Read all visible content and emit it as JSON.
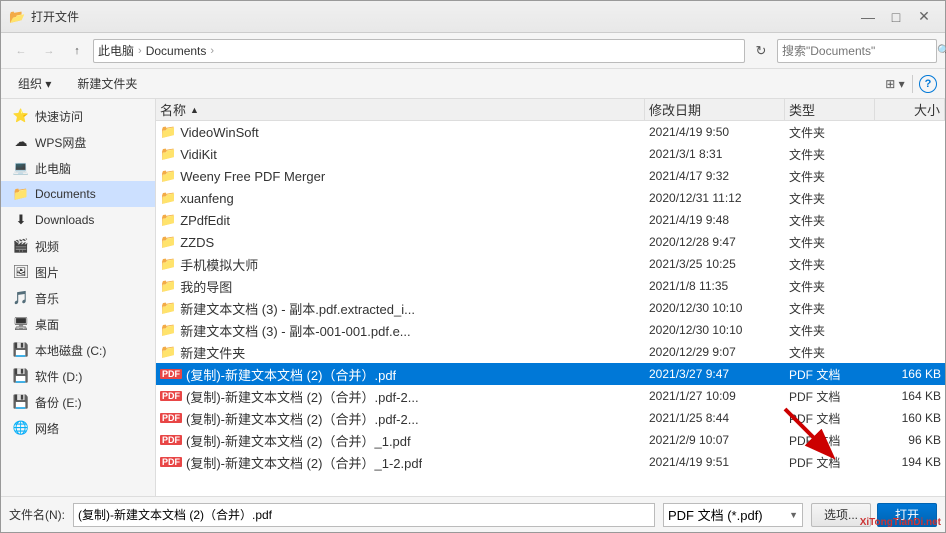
{
  "window": {
    "title": "打开文件",
    "icon": "📁"
  },
  "toolbar": {
    "back_label": "←",
    "forward_label": "→",
    "up_label": "↑",
    "breadcrumb": {
      "parts": [
        "此电脑",
        "Documents"
      ]
    },
    "refresh_label": "⟳",
    "search_placeholder": "搜索\"Documents\"",
    "search_icon": "🔍"
  },
  "action_bar": {
    "organize_label": "组织 ▾",
    "new_folder_label": "新建文件夹"
  },
  "sidebar": {
    "items": [
      {
        "id": "quick-access",
        "label": "快速访问",
        "icon": "⭐"
      },
      {
        "id": "wps",
        "label": "WPS网盘",
        "icon": "☁"
      },
      {
        "id": "this-pc",
        "label": "此电脑",
        "icon": "💻"
      },
      {
        "id": "documents",
        "label": "Documents",
        "icon": "📁",
        "selected": true
      },
      {
        "id": "downloads",
        "label": "Downloads",
        "icon": "⬇"
      },
      {
        "id": "videos",
        "label": "视频",
        "icon": "🎬"
      },
      {
        "id": "pictures",
        "label": "图片",
        "icon": "🖼"
      },
      {
        "id": "music",
        "label": "音乐",
        "icon": "🎵"
      },
      {
        "id": "desktop",
        "label": "桌面",
        "icon": "🖥"
      },
      {
        "id": "local-c",
        "label": "本地磁盘 (C:)",
        "icon": "💾"
      },
      {
        "id": "software-d",
        "label": "软件 (D:)",
        "icon": "💾"
      },
      {
        "id": "backup-e",
        "label": "备份 (E:)",
        "icon": "💾"
      },
      {
        "id": "network",
        "label": "网络",
        "icon": "🌐"
      }
    ]
  },
  "file_list": {
    "columns": {
      "name": "名称",
      "date": "修改日期",
      "type": "类型",
      "size": "大小"
    },
    "sort_column": "name",
    "sort_direction": "asc",
    "rows": [
      {
        "id": 1,
        "name": "VideoWinSoft",
        "date": "2021/4/19 9:50",
        "type": "文件夹",
        "size": "",
        "is_folder": true,
        "selected": false
      },
      {
        "id": 2,
        "name": "VidiKit",
        "date": "2021/3/1 8:31",
        "type": "文件夹",
        "size": "",
        "is_folder": true,
        "selected": false
      },
      {
        "id": 3,
        "name": "Weeny Free PDF Merger",
        "date": "2021/4/17 9:32",
        "type": "文件夹",
        "size": "",
        "is_folder": true,
        "selected": false
      },
      {
        "id": 4,
        "name": "xuanfeng",
        "date": "2020/12/31 11:12",
        "type": "文件夹",
        "size": "",
        "is_folder": true,
        "selected": false
      },
      {
        "id": 5,
        "name": "ZPdfEdit",
        "date": "2021/4/19 9:48",
        "type": "文件夹",
        "size": "",
        "is_folder": true,
        "selected": false
      },
      {
        "id": 6,
        "name": "ZZDS",
        "date": "2020/12/28 9:47",
        "type": "文件夹",
        "size": "",
        "is_folder": true,
        "selected": false
      },
      {
        "id": 7,
        "name": "手机模拟大师",
        "date": "2021/3/25 10:25",
        "type": "文件夹",
        "size": "",
        "is_folder": true,
        "selected": false
      },
      {
        "id": 8,
        "name": "我的导图",
        "date": "2021/1/8 11:35",
        "type": "文件夹",
        "size": "",
        "is_folder": true,
        "selected": false
      },
      {
        "id": 9,
        "name": "新建文本文档 (3) - 副本.pdf.extracted_i...",
        "date": "2020/12/30 10:10",
        "type": "文件夹",
        "size": "",
        "is_folder": true,
        "selected": false
      },
      {
        "id": 10,
        "name": "新建文本文档 (3) - 副本-001-001.pdf.e...",
        "date": "2020/12/30 10:10",
        "type": "文件夹",
        "size": "",
        "is_folder": true,
        "selected": false
      },
      {
        "id": 11,
        "name": "新建文件夹",
        "date": "2020/12/29 9:07",
        "type": "文件夹",
        "size": "",
        "is_folder": true,
        "selected": false
      },
      {
        "id": 12,
        "name": "(复制)-新建文本文档 (2)（合并）.pdf",
        "date": "2021/3/27 9:47",
        "type": "PDF 文档",
        "size": "166 KB",
        "is_folder": false,
        "selected": true
      },
      {
        "id": 13,
        "name": "(复制)-新建文本文档 (2)（合并）.pdf-2...",
        "date": "2021/1/27 10:09",
        "type": "PDF 文档",
        "size": "164 KB",
        "is_folder": false,
        "selected": false
      },
      {
        "id": 14,
        "name": "(复制)-新建文本文档 (2)（合并）.pdf-2...",
        "date": "2021/1/25 8:44",
        "type": "PDF 文档",
        "size": "160 KB",
        "is_folder": false,
        "selected": false
      },
      {
        "id": 15,
        "name": "(复制)-新建文本文档 (2)（合并）_1.pdf",
        "date": "2021/2/9 10:07",
        "type": "PDF 文档",
        "size": "96 KB",
        "is_folder": false,
        "selected": false
      },
      {
        "id": 16,
        "name": "(复制)-新建文本文档 (2)（合并）_1-2.pdf",
        "date": "2021/4/19 9:51",
        "type": "PDF 文档",
        "size": "194 KB",
        "is_folder": false,
        "selected": false
      }
    ]
  },
  "bottom": {
    "filename_label": "文件名(N):",
    "filename_value": "(复制)-新建文本文档 (2)（合并）.pdf",
    "filetype_value": "PDF 文档 (*.pdf)",
    "open_label": "打开",
    "cancel_label": "选项..."
  },
  "titlebar_buttons": {
    "minimize": "—",
    "maximize": "□",
    "close": "✕"
  }
}
